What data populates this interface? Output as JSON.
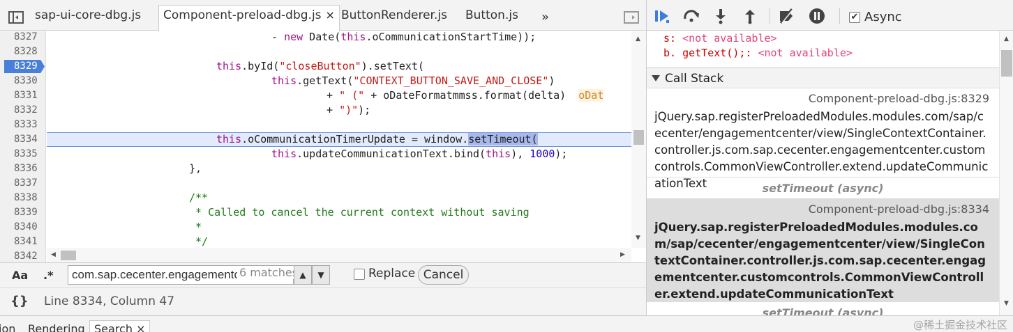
{
  "tabs": {
    "items": [
      {
        "label": "sap-ui-core-dbg.js"
      },
      {
        "label": "Component-preload-dbg.js",
        "close": "×"
      },
      {
        "label": "ButtonRenderer.js"
      },
      {
        "label": "Button.js"
      }
    ],
    "more": "»"
  },
  "editor": {
    "line_numbers": [
      "8327",
      "8328",
      "8329",
      "8330",
      "8331",
      "8332",
      "8333",
      "8334",
      "8335",
      "8336",
      "8337",
      "8338",
      "8339",
      "8340",
      "8341",
      "8342"
    ],
    "breakpoint_line": "8329",
    "execution_line": "8334",
    "code": {
      "l8327_a": "- ",
      "l8327_kw": "new",
      "l8327_b": " Date(",
      "l8327_kw2": "this",
      "l8327_c": ".oCommunicationStartTime));",
      "l8329_kw": "this",
      "l8329_a": ".byId(",
      "l8329_str": "\"closeButton\"",
      "l8329_b": ").setText(",
      "l8330_kw": "this",
      "l8330_a": ".getText(",
      "l8330_str": "\"CONTEXT_BUTTON_SAVE_AND_CLOSE\"",
      "l8330_b": ")",
      "l8331_a": "+ ",
      "l8331_str": "\" (\"",
      "l8331_b": " + oDateFormatmmss.format(delta)",
      "l8331_hint": "oDat",
      "l8332_a": "+ ",
      "l8332_str": "\")\"",
      "l8332_b": ");",
      "l8334_kw": "this",
      "l8334_a": ".oCommunicationTimerUpdate = window.",
      "l8334_sel": "setTimeout(",
      "l8335_kw": "this",
      "l8335_a": ".updateCommunicationText.bind(",
      "l8335_kw2": "this",
      "l8335_b": "), ",
      "l8335_num": "1000",
      "l8335_c": ");",
      "l8336": "},",
      "l8338": "/**",
      "l8339": " * Called to cancel the current context without saving",
      "l8340": " *",
      "l8341": " */"
    }
  },
  "search": {
    "case_toggle": "Aa",
    "regex_toggle": ".*",
    "query": "com.sap.cecenter.engagementcenter",
    "matches": "6 matches",
    "prev": "▲",
    "next": "▼",
    "replace_label": "Replace",
    "cancel_label": "Cancel"
  },
  "status": {
    "pretty_print": "{}",
    "cursor_position": "Line 8334, Column 47"
  },
  "drawer": {
    "tabs": [
      "ion",
      "Rendering",
      "Search"
    ],
    "close": "×",
    "watermark": "@稀土掘金技术社区"
  },
  "debugger": {
    "async_label": "Async",
    "async_checked": "✔",
    "watch": [
      {
        "name": "s",
        "sep": ": ",
        "value": "<not available>"
      },
      {
        "name": "b. getText();",
        "sep": ": ",
        "value": "<not available>"
      }
    ],
    "call_stack_title": "Call Stack",
    "frames": [
      {
        "location": "Component-preload-dbg.js:8329",
        "function": "jQuery.sap.registerPreloadedModules.modules.com/sap/cecenter/engagementcenter/view/SingleContextContainer.controller.js.com.sap.cecenter.engagementcenter.customcontrols.CommonViewController.extend.updateCommunicationText"
      },
      {
        "location": "Component-preload-dbg.js:8334",
        "function": "jQuery.sap.registerPreloadedModules.modules.com/sap/cecenter/engagementcenter/view/SingleContextContainer.controller.js.com.sap.cecenter.engagementcenter.customcontrols.CommonViewController.extend.updateCommunicationText"
      }
    ],
    "async_separator": "setTimeout (async)",
    "async_separator_2": "setTimeout (async)"
  },
  "colors": {
    "breakpoint": "#4a7fd9",
    "keyword": "#a0148a",
    "string": "#c41a16",
    "number": "#1c00cf",
    "comment": "#247a1d",
    "execution_line": "#e2ebfb"
  }
}
